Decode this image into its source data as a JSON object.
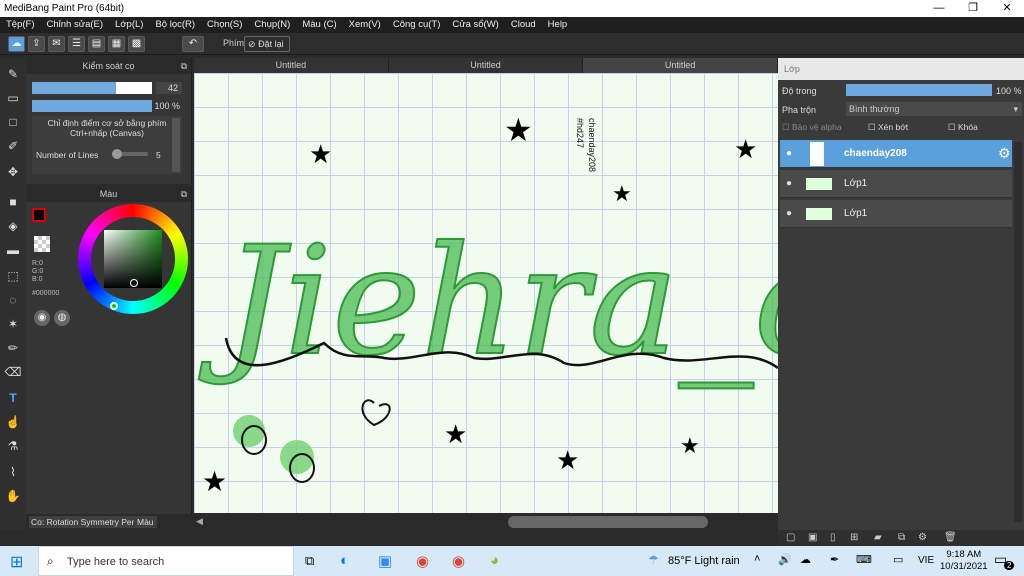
{
  "app": {
    "title": "MediBang Paint Pro (64bit)"
  },
  "menu": [
    "Tệp(F)",
    "Chỉnh sửa(E)",
    "Lớp(L)",
    "Bộ lọc(R)",
    "Chọn(S)",
    "Chụp(N)",
    "Màu (C)",
    "Xem(V)",
    "Công cụ(T)",
    "Cửa sổ(W)",
    "Cloud",
    "Help"
  ],
  "toolbar": {
    "key_label": "Phím",
    "reset_label": "Đặt lại"
  },
  "brush_panel": {
    "title": "Kiểm soát cọ",
    "size": "42",
    "opacity": "100 %",
    "hint_line1": "Chỉ định điểm cơ sở bằng phím",
    "hint_line2": "Ctrl+nhấp (Canvas)",
    "lines_label": "Number of Lines",
    "lines_value": "5",
    "size_fraction": 0.7,
    "opacity_fraction": 1.0
  },
  "color_panel": {
    "title": "Màu",
    "r": "R:0",
    "g": "G:0",
    "b": "B:0",
    "hex": "#000000"
  },
  "status": {
    "tool": "Co: Rotation Symmetry Pen",
    "tab2": "Màu"
  },
  "tabs": [
    "Untitled",
    "Untitled",
    "Untitled"
  ],
  "canvas": {
    "art_text": "Jiehra_ch",
    "vertical1": "chaenday208",
    "vertical2": "#hd247"
  },
  "layers_panel": {
    "title": "Lớp",
    "opacity_label": "Độ trong",
    "opacity_value": "100 %",
    "blend_label": "Pha trộn",
    "blend_value": "Bình thường",
    "protect_alpha": "Bảo vệ alpha",
    "clip": "Xén bớt",
    "lock": "Khóa",
    "layers": [
      {
        "name": "chaenday208"
      },
      {
        "name": "Lớp1"
      },
      {
        "name": "Lớp1"
      }
    ]
  },
  "taskbar": {
    "search_placeholder": "Type here to search",
    "weather": "85°F  Light rain",
    "lang": "VIE",
    "time": "9:18 AM",
    "date": "10/31/2021",
    "notif": "2"
  },
  "colors": {
    "accent": "#5aa0dc",
    "green": "#3fb84a"
  }
}
